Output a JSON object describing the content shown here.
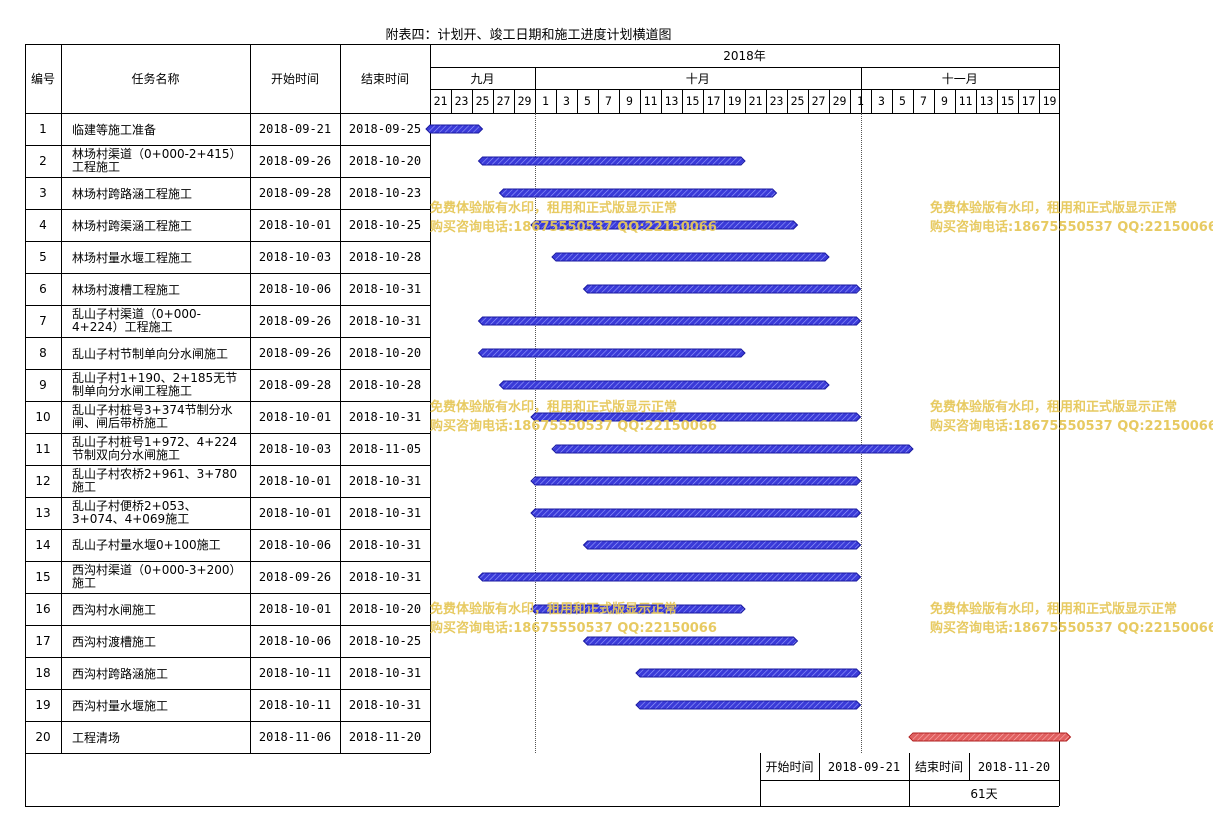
{
  "title": "附表四：计划开、竣工日期和施工进度计划横道图",
  "headers": {
    "no": "编号",
    "name": "任务名称",
    "start": "开始时间",
    "end": "结束时间",
    "year": "2018年",
    "months": [
      "九月",
      "十月",
      "十一月"
    ],
    "days": [
      "21",
      "23",
      "25",
      "27",
      "29",
      "1",
      "3",
      "5",
      "7",
      "9",
      "11",
      "13",
      "15",
      "17",
      "19",
      "21",
      "23",
      "25",
      "27",
      "29",
      "1",
      "3",
      "5",
      "7",
      "9",
      "11",
      "13",
      "15",
      "17",
      "19"
    ]
  },
  "rows": [
    {
      "no": "1",
      "name": "临建等施工准备",
      "start": "2018-09-21",
      "end": "2018-09-25"
    },
    {
      "no": "2",
      "name": "林场村渠道（0+000-2+415）工程施工",
      "start": "2018-09-26",
      "end": "2018-10-20"
    },
    {
      "no": "3",
      "name": "林场村跨路涵工程施工",
      "start": "2018-09-28",
      "end": "2018-10-23"
    },
    {
      "no": "4",
      "name": "林场村跨渠涵工程施工",
      "start": "2018-10-01",
      "end": "2018-10-25"
    },
    {
      "no": "5",
      "name": "林场村量水堰工程施工",
      "start": "2018-10-03",
      "end": "2018-10-28"
    },
    {
      "no": "6",
      "name": "林场村渡槽工程施工",
      "start": "2018-10-06",
      "end": "2018-10-31"
    },
    {
      "no": "7",
      "name": "乱山子村渠道（0+000-4+224）工程施工",
      "start": "2018-09-26",
      "end": "2018-10-31"
    },
    {
      "no": "8",
      "name": "乱山子村节制单向分水闸施工",
      "start": "2018-09-26",
      "end": "2018-10-20"
    },
    {
      "no": "9",
      "name": "乱山子村1+190、2+185无节制单向分水闸工程施工",
      "start": "2018-09-28",
      "end": "2018-10-28"
    },
    {
      "no": "10",
      "name": "乱山子村桩号3+374节制分水闸、闸后带桥施工",
      "start": "2018-10-01",
      "end": "2018-10-31"
    },
    {
      "no": "11",
      "name": "乱山子村桩号1+972、4+224节制双向分水闸施工",
      "start": "2018-10-03",
      "end": "2018-11-05"
    },
    {
      "no": "12",
      "name": "乱山子村农桥2+961、3+780施工",
      "start": "2018-10-01",
      "end": "2018-10-31"
    },
    {
      "no": "13",
      "name": "乱山子村便桥2+053、3+074、4+069施工",
      "start": "2018-10-01",
      "end": "2018-10-31"
    },
    {
      "no": "14",
      "name": "乱山子村量水堰0+100施工",
      "start": "2018-10-06",
      "end": "2018-10-31"
    },
    {
      "no": "15",
      "name": "西沟村渠道（0+000-3+200）施工",
      "start": "2018-09-26",
      "end": "2018-10-31"
    },
    {
      "no": "16",
      "name": "西沟村水闸施工",
      "start": "2018-10-01",
      "end": "2018-10-20"
    },
    {
      "no": "17",
      "name": "西沟村渡槽施工",
      "start": "2018-10-06",
      "end": "2018-10-25"
    },
    {
      "no": "18",
      "name": "西沟村跨路涵施工",
      "start": "2018-10-11",
      "end": "2018-10-31"
    },
    {
      "no": "19",
      "name": "西沟村量水堰施工",
      "start": "2018-10-11",
      "end": "2018-10-31"
    },
    {
      "no": "20",
      "name": "工程清场",
      "start": "2018-11-06",
      "end": "2018-11-20"
    }
  ],
  "footer": {
    "start_label": "开始时间",
    "start_value": "2018-09-21",
    "end_label": "结束时间",
    "end_value": "2018-11-20",
    "duration": "61天"
  },
  "watermark": {
    "line1": "免费体验版有水印，租用和正式版显示正常",
    "line2": "购买咨询电话:18675550537 QQ:22150066"
  },
  "chart_data": {
    "type": "gantt",
    "x_range": [
      "2018-09-21",
      "2018-11-20"
    ],
    "tasks": [
      {
        "id": 1,
        "start": "2018-09-21",
        "end": "2018-09-25"
      },
      {
        "id": 2,
        "start": "2018-09-26",
        "end": "2018-10-20"
      },
      {
        "id": 3,
        "start": "2018-09-28",
        "end": "2018-10-23"
      },
      {
        "id": 4,
        "start": "2018-10-01",
        "end": "2018-10-25"
      },
      {
        "id": 5,
        "start": "2018-10-03",
        "end": "2018-10-28"
      },
      {
        "id": 6,
        "start": "2018-10-06",
        "end": "2018-10-31"
      },
      {
        "id": 7,
        "start": "2018-09-26",
        "end": "2018-10-31"
      },
      {
        "id": 8,
        "start": "2018-09-26",
        "end": "2018-10-20"
      },
      {
        "id": 9,
        "start": "2018-09-28",
        "end": "2018-10-28"
      },
      {
        "id": 10,
        "start": "2018-10-01",
        "end": "2018-10-31"
      },
      {
        "id": 11,
        "start": "2018-10-03",
        "end": "2018-11-05"
      },
      {
        "id": 12,
        "start": "2018-10-01",
        "end": "2018-10-31"
      },
      {
        "id": 13,
        "start": "2018-10-01",
        "end": "2018-10-31"
      },
      {
        "id": 14,
        "start": "2018-10-06",
        "end": "2018-10-31"
      },
      {
        "id": 15,
        "start": "2018-09-26",
        "end": "2018-10-31"
      },
      {
        "id": 16,
        "start": "2018-10-01",
        "end": "2018-10-20"
      },
      {
        "id": 17,
        "start": "2018-10-06",
        "end": "2018-10-25"
      },
      {
        "id": 18,
        "start": "2018-10-11",
        "end": "2018-10-31"
      },
      {
        "id": 19,
        "start": "2018-10-11",
        "end": "2018-10-31"
      },
      {
        "id": 20,
        "start": "2018-11-06",
        "end": "2018-11-20"
      }
    ],
    "colors": {
      "bar": "#3a3ad8",
      "bar_border": "#1a1aa0",
      "final_bar": "#e06060",
      "final_border": "#b02020",
      "watermark": "#e6c85a"
    }
  }
}
